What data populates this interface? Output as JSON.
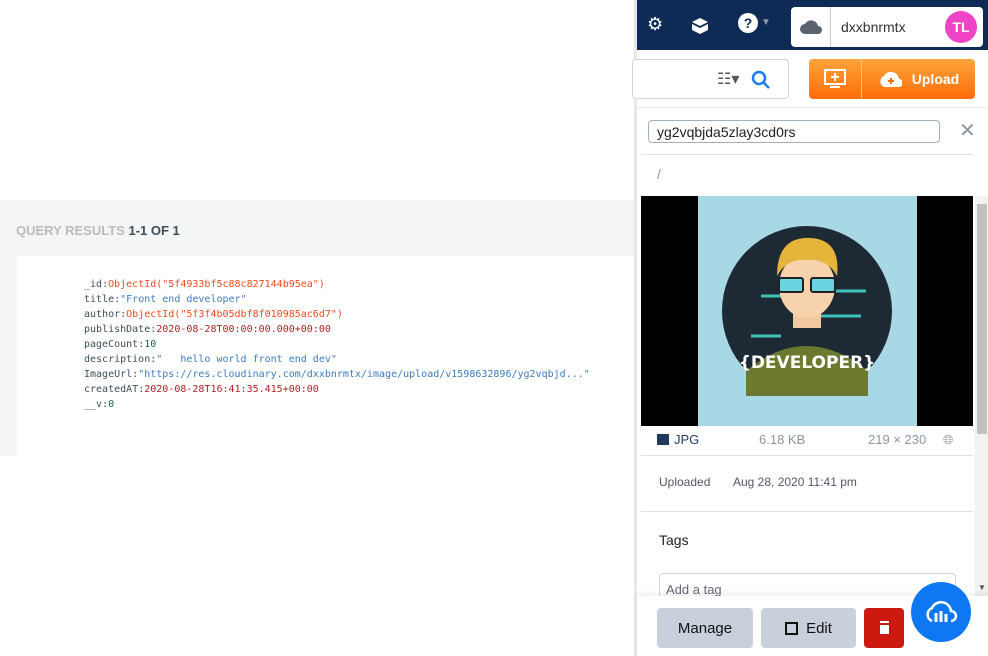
{
  "query": {
    "label": "QUERY RESULTS",
    "range": "1-1 OF 1",
    "fields": [
      {
        "key": "_id",
        "value": "ObjectId(\"5f4933bf5c88c827144b95ea\")",
        "type": "oid"
      },
      {
        "key": "title",
        "value": "\"Front end developer\"",
        "type": "str"
      },
      {
        "key": "author",
        "value": "ObjectId(\"5f3f4b05dbf8f010985ac6d7\")",
        "type": "oid"
      },
      {
        "key": "publishDate",
        "value": "2020-08-28T00:00:00.000+00:00",
        "type": "date"
      },
      {
        "key": "pageCount",
        "value": "10",
        "type": "num"
      },
      {
        "key": "description",
        "value": "\"   hello world front end dev\"",
        "type": "str"
      },
      {
        "key": "ImageUrl",
        "value": "\"https://res.cloudinary.com/dxxbnrmtx/image/upload/v1598632896/yg2vqbjd...\"",
        "type": "str"
      },
      {
        "key": "createdAT",
        "value": "2020-08-28T16:41:35.415+00:00",
        "type": "date"
      },
      {
        "key": "__v",
        "value": "0",
        "type": "num"
      }
    ]
  },
  "topbar": {
    "cloud_name": "dxxbnrmtx",
    "avatar_initials": "TL",
    "avatar_color": "#ee44c5",
    "icons": [
      "gear-icon",
      "package-icon",
      "help-icon"
    ]
  },
  "toolbar": {
    "upload_label": "Upload",
    "accent": "#ff8a1f"
  },
  "asset": {
    "public_id": "yg2vqbjda5zlay3cd0rs",
    "folder": "/",
    "format": "JPG",
    "size": "6.18 KB",
    "dimensions": "219 × 230",
    "uploaded_label": "Uploaded",
    "uploaded_value": "Aug 28, 2020 11:41 pm",
    "image_text": "{DEVELOPER}"
  },
  "tags": {
    "label": "Tags",
    "placeholder": "Add a tag"
  },
  "footer": {
    "manage": "Manage",
    "edit": "Edit"
  }
}
